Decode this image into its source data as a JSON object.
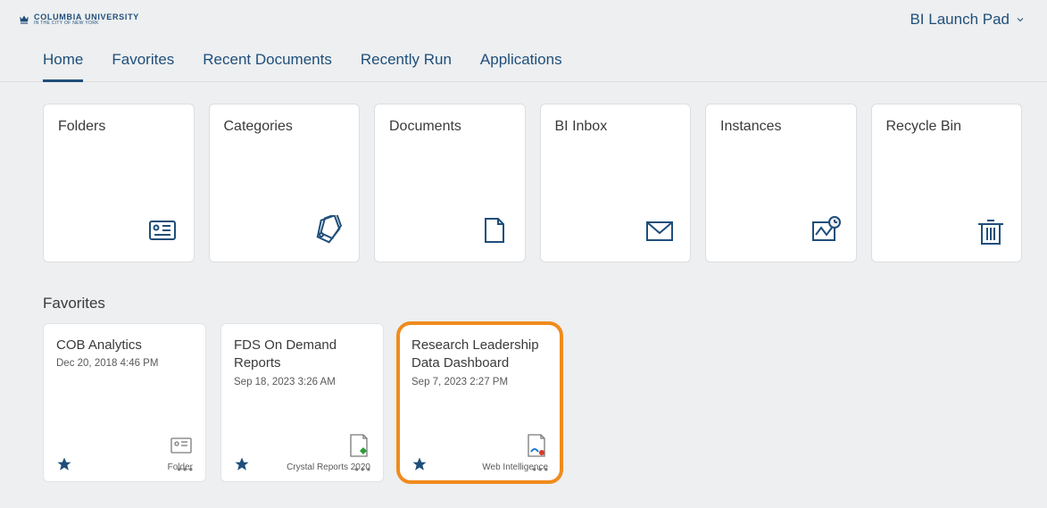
{
  "branding": {
    "main": "COLUMBIA UNIVERSITY",
    "sub": "IN THE CITY OF NEW YORK"
  },
  "app_title": "BI Launch Pad",
  "tabs": [
    {
      "label": "Home",
      "active": true
    },
    {
      "label": "Favorites",
      "active": false
    },
    {
      "label": "Recent Documents",
      "active": false
    },
    {
      "label": "Recently Run",
      "active": false
    },
    {
      "label": "Applications",
      "active": false
    }
  ],
  "tiles": [
    {
      "label": "Folders",
      "icon": "folder-card-icon"
    },
    {
      "label": "Categories",
      "icon": "tag-icon"
    },
    {
      "label": "Documents",
      "icon": "page-icon"
    },
    {
      "label": "BI Inbox",
      "icon": "envelope-icon"
    },
    {
      "label": "Instances",
      "icon": "instances-icon"
    },
    {
      "label": "Recycle Bin",
      "icon": "trash-icon"
    }
  ],
  "favorites_heading": "Favorites",
  "favorites": [
    {
      "title": "COB Analytics",
      "date": "Dec 20, 2018 4:46 PM",
      "type": "Folder",
      "type_icon": "folder-mini-icon",
      "highlight": false
    },
    {
      "title": "FDS On Demand Reports",
      "date": "Sep 18, 2023 3:26 AM",
      "type": "Crystal Reports 2020",
      "type_icon": "crystal-icon",
      "highlight": false
    },
    {
      "title": "Research Leadership Data Dashboard",
      "date": "Sep 7, 2023 2:27 PM",
      "type": "Web Intelligence",
      "type_icon": "webi-icon",
      "highlight": true
    }
  ]
}
